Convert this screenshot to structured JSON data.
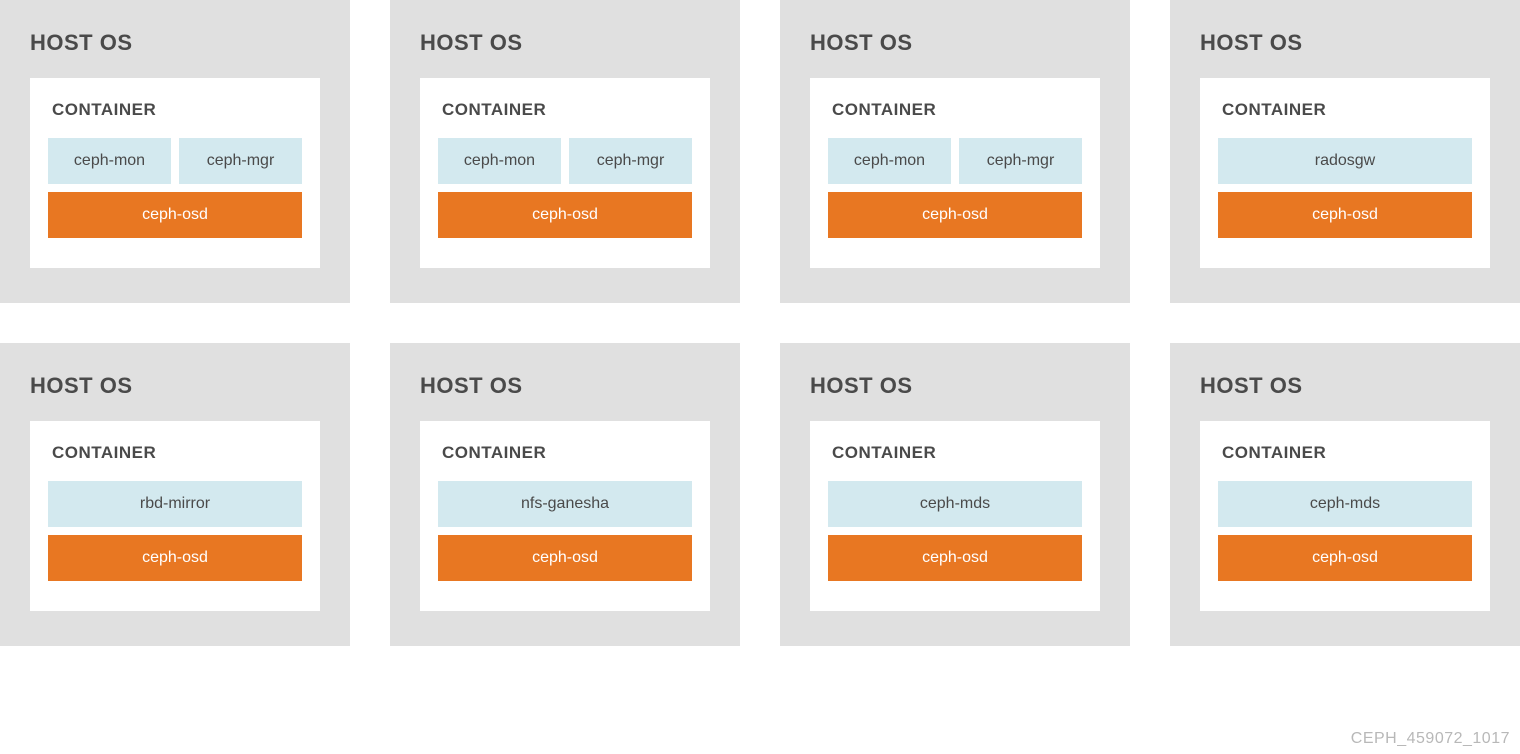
{
  "footer": "CEPH_459072_1017",
  "host_label": "HOST OS",
  "container_label": "CONTAINER",
  "hosts": [
    {
      "top": [
        "ceph-mon",
        "ceph-mgr"
      ],
      "bottom": "ceph-osd"
    },
    {
      "top": [
        "ceph-mon",
        "ceph-mgr"
      ],
      "bottom": "ceph-osd"
    },
    {
      "top": [
        "ceph-mon",
        "ceph-mgr"
      ],
      "bottom": "ceph-osd"
    },
    {
      "top": [
        "radosgw"
      ],
      "bottom": "ceph-osd"
    },
    {
      "top": [
        "rbd-mirror"
      ],
      "bottom": "ceph-osd"
    },
    {
      "top": [
        "nfs-ganesha"
      ],
      "bottom": "ceph-osd"
    },
    {
      "top": [
        "ceph-mds"
      ],
      "bottom": "ceph-osd"
    },
    {
      "top": [
        "ceph-mds"
      ],
      "bottom": "ceph-osd"
    }
  ]
}
